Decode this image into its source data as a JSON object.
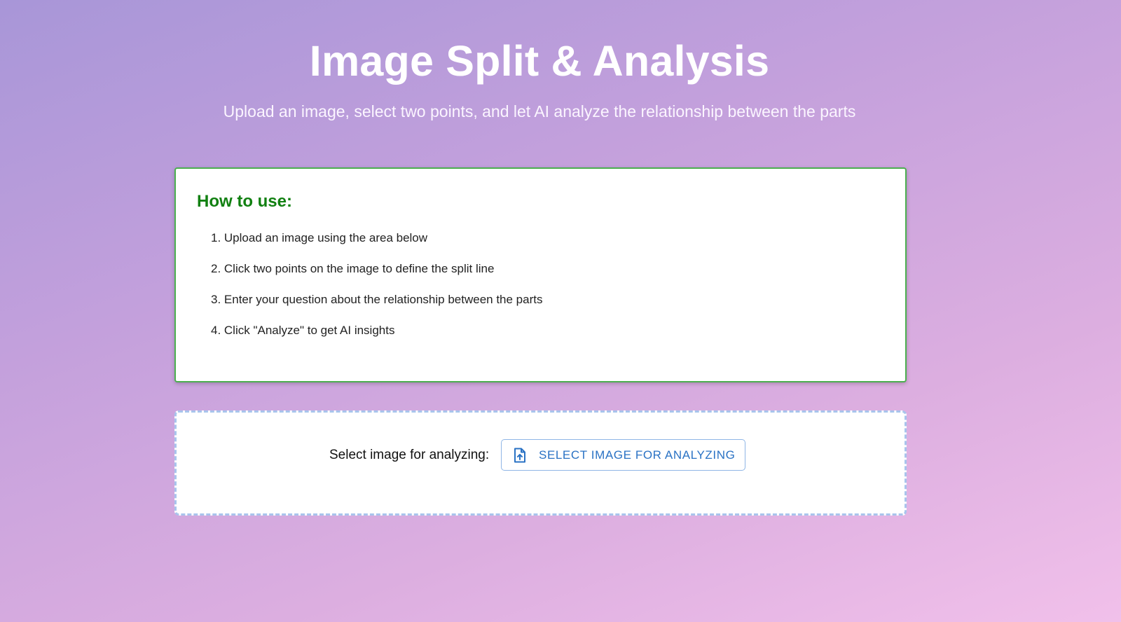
{
  "header": {
    "title": "Image Split & Analysis",
    "subtitle": "Upload an image, select two points, and let AI analyze the relationship between the parts"
  },
  "instructions": {
    "title": "How to use:",
    "steps": [
      "1. Upload an image using the area below",
      "2. Click two points on the image to define the split line",
      "3. Enter your question about the relationship between the parts",
      "4. Click \"Analyze\" to get AI insights"
    ]
  },
  "upload": {
    "label": "Select image for analyzing:",
    "button_label": "SELECT IMAGE FOR ANALYZING",
    "button_icon": "file-upload-icon"
  },
  "colors": {
    "accent_green": "#118011",
    "card_border": "#4caf50",
    "button_text": "#2a72c4"
  }
}
